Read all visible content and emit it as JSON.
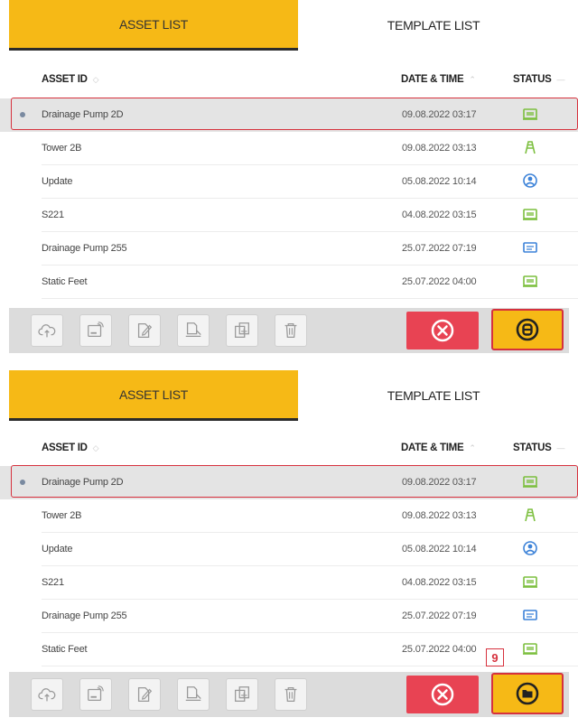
{
  "tabs": {
    "asset_list": "ASSET LIST",
    "template_list": "TEMPLATE LIST"
  },
  "columns": {
    "asset_id": "ASSET ID",
    "date_time": "DATE & TIME",
    "status": "STATUS"
  },
  "rows": [
    {
      "name": "Drainage Pump 2D",
      "date": "09.08.2022 03:17",
      "status_icon": "machine-green-icon",
      "selected": true
    },
    {
      "name": "Tower 2B",
      "date": "09.08.2022 03:13",
      "status_icon": "tower-green-icon",
      "selected": false
    },
    {
      "name": "Update",
      "date": "05.08.2022 10:14",
      "status_icon": "person-blue-icon",
      "selected": false
    },
    {
      "name": "S221",
      "date": "04.08.2022 03:15",
      "status_icon": "machine-green-icon",
      "selected": false
    },
    {
      "name": "Drainage Pump 255",
      "date": "25.07.2022 07:19",
      "status_icon": "template-blue-icon",
      "selected": false
    },
    {
      "name": "Static Feet",
      "date": "25.07.2022 04:00",
      "status_icon": "machine-green-icon",
      "selected": false
    }
  ],
  "toolbar": {
    "icons": [
      "cloud-upload-icon",
      "rfid-icon",
      "edit-icon",
      "print-icon",
      "copy-icon",
      "trash-icon"
    ],
    "cancel_icon": "close-circle-icon",
    "panel1_primary_icon": "asset-circle-icon",
    "panel2_primary_icon": "open-folder-icon"
  },
  "step_badge": "9",
  "colors": {
    "accent": "#f6b916",
    "cancel": "#e84353",
    "highlight": "#d6313d",
    "status_green": "#7cbf3e",
    "status_blue": "#3c82d8"
  }
}
